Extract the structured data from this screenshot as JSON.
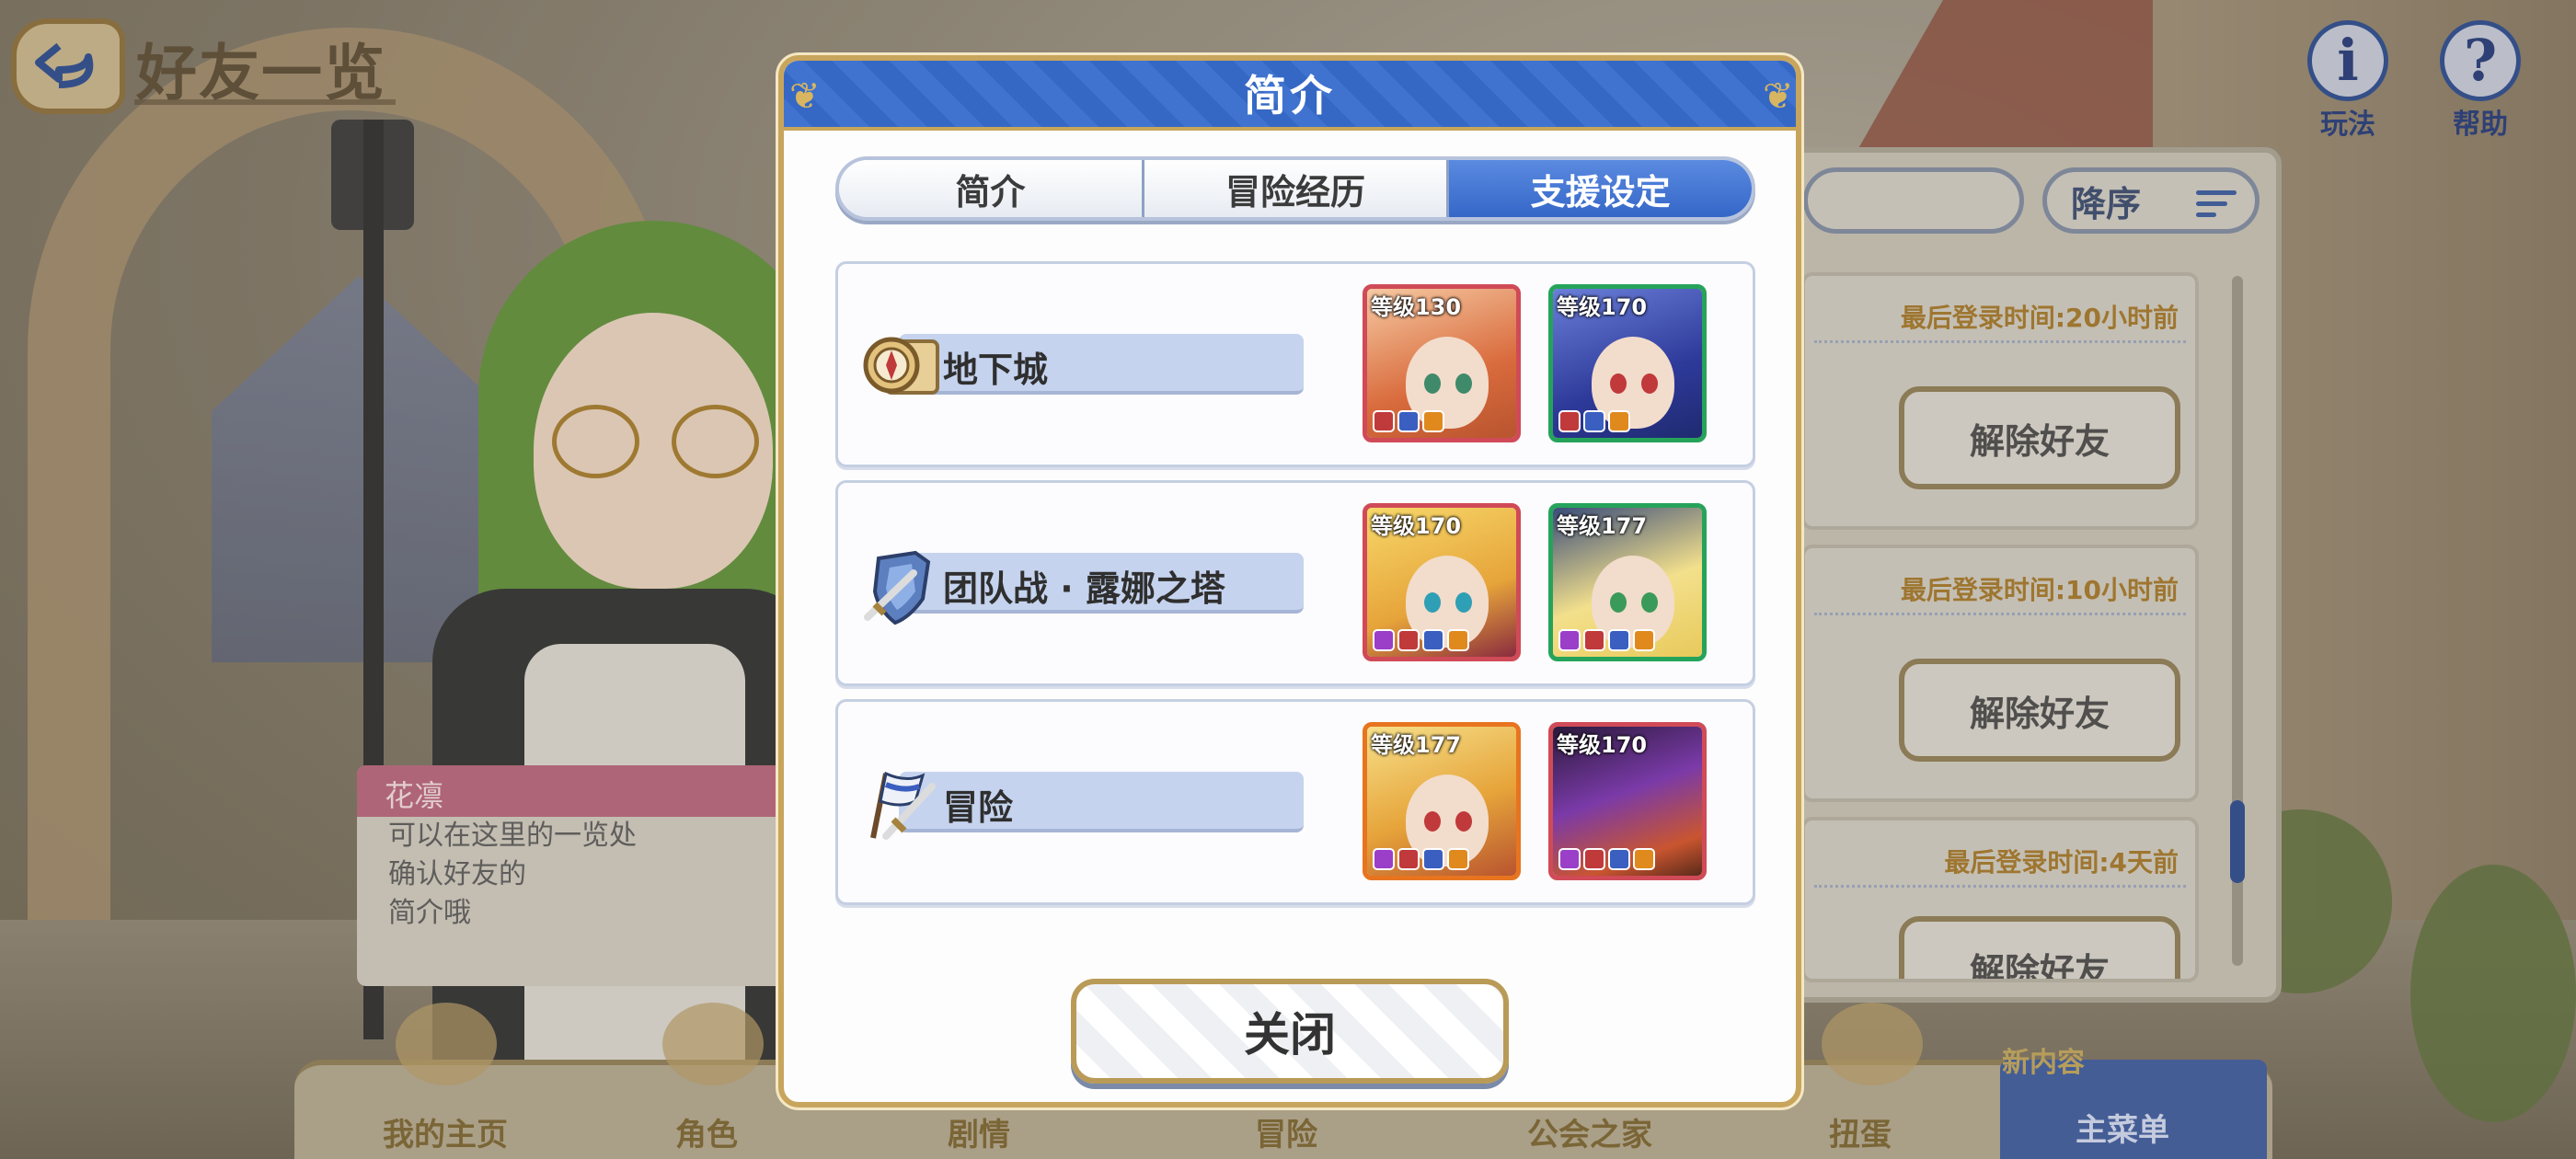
{
  "header": {
    "title": "好友一览"
  },
  "top_right": {
    "rules_label": "玩法",
    "help_label": "帮助"
  },
  "friend_list": {
    "sort_label": "降序",
    "friends": [
      {
        "last_login": "最后登录时间:20小时前",
        "unfriend_label": "解除好友"
      },
      {
        "last_login": "最后登录时间:10小时前",
        "unfriend_label": "解除好友"
      },
      {
        "last_login": "最后登录时间:4天前",
        "unfriend_label": "解除好友"
      }
    ]
  },
  "dialogue": {
    "speaker": "花凛",
    "lines": [
      "可以在这里的一览处",
      "确认好友的",
      "简介哦"
    ]
  },
  "bottom_nav": {
    "items": [
      "我的主页",
      "角色",
      "剧情",
      "冒险",
      "公会之家",
      "扭蛋",
      "主菜单"
    ],
    "new_content_badge": "新内容"
  },
  "modal": {
    "title": "简介",
    "tabs": [
      "简介",
      "冒险经历",
      "支援设定"
    ],
    "active_tab": "支援设定",
    "rows": [
      {
        "label": "地下城",
        "icon": "map-compass-icon",
        "units": [
          {
            "level": "等级130",
            "frame": "red"
          },
          {
            "level": "等级170",
            "frame": "green"
          }
        ]
      },
      {
        "label": "团队战 · 露娜之塔",
        "icon": "shield-sword-icon",
        "units": [
          {
            "level": "等级170",
            "frame": "red"
          },
          {
            "level": "等级177",
            "frame": "green"
          }
        ]
      },
      {
        "label": "冒险",
        "icon": "flag-sword-icon",
        "units": [
          {
            "level": "等级177",
            "frame": "orange"
          },
          {
            "level": "等级170",
            "frame": "red"
          }
        ]
      }
    ],
    "close_label": "关闭"
  },
  "colors": {
    "modal_header": "#3f73cf",
    "active_tab": "#3567c8",
    "gold_border": "#c8a55c"
  }
}
